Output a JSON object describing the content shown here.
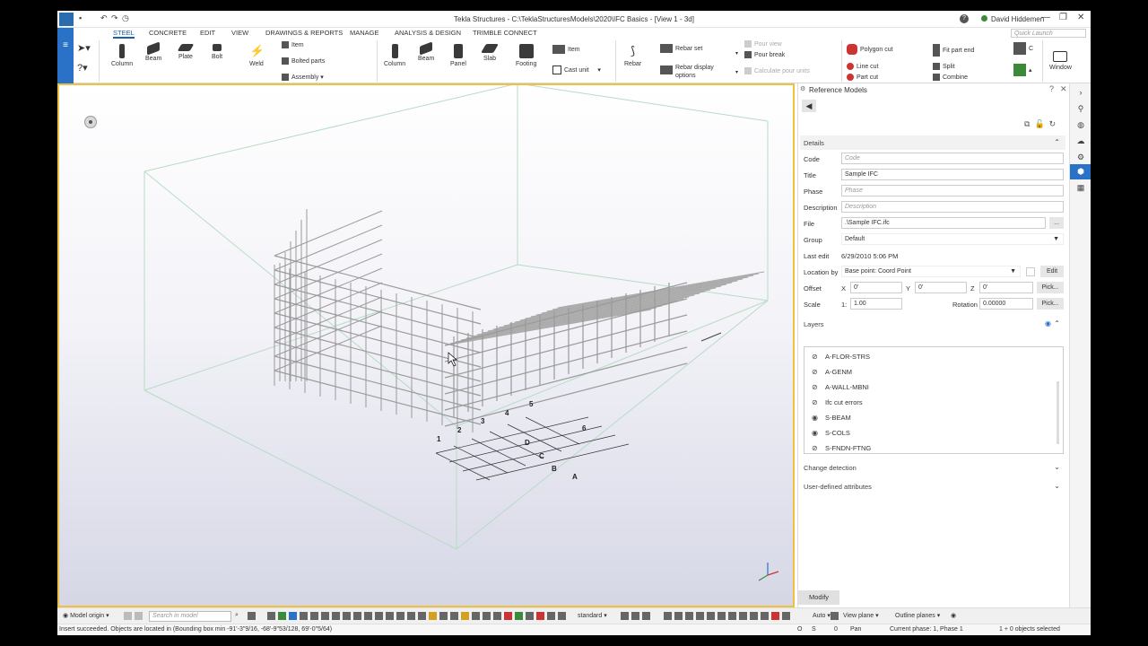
{
  "window": {
    "title": "Tekla Structures - C:\\TeklaStructuresModels\\2020\\IFC Basics - [View 1 - 3d]",
    "user": "David Hiddemen",
    "quick_launch_placeholder": "Quick Launch"
  },
  "ribbon": {
    "tabs": [
      "STEEL",
      "CONCRETE",
      "EDIT",
      "VIEW",
      "DRAWINGS & REPORTS",
      "MANAGE",
      "ANALYSIS & DESIGN",
      "TRIMBLE CONNECT"
    ],
    "active_tab": "STEEL",
    "steel": {
      "column": "Column",
      "beam": "Beam",
      "plate": "Plate",
      "bolt": "Bolt",
      "weld": "Weld",
      "item": "Item",
      "bolted_parts": "Bolted parts",
      "assembly": "Assembly"
    },
    "concrete": {
      "column": "Column",
      "beam": "Beam",
      "panel": "Panel",
      "slab": "Slab",
      "footing": "Footing",
      "item": "Item",
      "cast_unit": "Cast unit"
    },
    "rebar": {
      "rebar": "Rebar",
      "rebar_set": "Rebar set",
      "rebar_display_options": "Rebar display options",
      "pour_view": "Pour view",
      "pour_break": "Pour break",
      "calculate_pour_units": "Calculate pour units"
    },
    "edit": {
      "polygon_cut": "Polygon cut",
      "line_cut": "Line cut",
      "part_cut": "Part cut",
      "fit_part_end": "Fit part end",
      "split": "Split",
      "combine": "Combine"
    },
    "window": "Window"
  },
  "viewport": {
    "grid_labels": [
      "1",
      "2",
      "3",
      "4",
      "5",
      "6",
      "A",
      "B",
      "C",
      "D"
    ]
  },
  "panel": {
    "title": "Reference Models",
    "details_label": "Details",
    "fields": {
      "code_label": "Code",
      "code_placeholder": "Code",
      "title_label": "Title",
      "title_value": "Sample IFC",
      "phase_label": "Phase",
      "phase_placeholder": "Phase",
      "description_label": "Description",
      "description_placeholder": "Description",
      "file_label": "File",
      "file_value": ".\\Sample IFC.ifc",
      "file_browse": "...",
      "group_label": "Group",
      "group_value": "Default",
      "last_edit_label": "Last edit",
      "last_edit_value": "6/29/2010 5:06 PM",
      "location_label": "Location by",
      "location_value": "Base point: Coord Point",
      "edit_button": "Edit",
      "offset_label": "Offset",
      "x_label": "X",
      "x_value": "0'",
      "y_label": "Y",
      "y_value": "0'",
      "z_label": "Z",
      "z_value": "0'",
      "pick_button": "Pick...",
      "scale_label": "Scale",
      "scale_prefix": "1:",
      "scale_value": "1.00",
      "rotation_label": "Rotation",
      "rotation_value": "0.00000"
    },
    "layers_label": "Layers",
    "layers": [
      {
        "name": "A-FLOR-STRS",
        "visible": false
      },
      {
        "name": "A-GENM",
        "visible": false
      },
      {
        "name": "A-WALL-MBNI",
        "visible": false
      },
      {
        "name": "Ifc cut errors",
        "visible": false
      },
      {
        "name": "S-BEAM",
        "visible": true
      },
      {
        "name": "S-COLS",
        "visible": true
      },
      {
        "name": "S-FNDN-FTNG",
        "visible": false
      }
    ],
    "change_detection_label": "Change detection",
    "user_attributes_label": "User-defined attributes",
    "modify_button": "Modify"
  },
  "bottombar": {
    "model_origin": "Model origin",
    "search_placeholder": "Search in model",
    "standard": "standard",
    "auto": "Auto",
    "view_plane": "View plane",
    "outline_planes": "Outline planes"
  },
  "status": {
    "message": "Insert succeeded. Objects are located in (Bounding box min -91'-3\"9/16, -68'-9\"53/128, 69'-0\"5/64)",
    "o_label": "O",
    "s_label": "S",
    "zero": "0",
    "pan": "Pan",
    "phase": "Current phase: 1, Phase 1",
    "selection": "1 + 0 objects selected"
  },
  "colors": {
    "accent": "#2a72c8",
    "viewport_border": "#f0c040"
  }
}
